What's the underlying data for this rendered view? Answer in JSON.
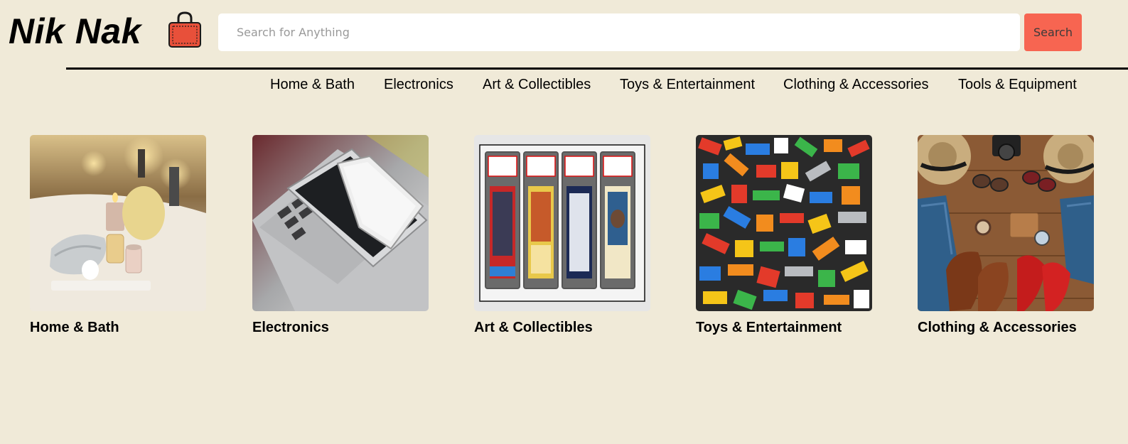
{
  "brand": {
    "name": "Nik Nak",
    "icon": "shopping-bag-icon",
    "icon_color": "#e8503a"
  },
  "search": {
    "placeholder": "Search for Anything",
    "value": "",
    "button_label": "Search",
    "button_color": "#f76551"
  },
  "nav": {
    "items": [
      {
        "label": "Home & Bath"
      },
      {
        "label": "Electronics"
      },
      {
        "label": "Art & Collectibles"
      },
      {
        "label": "Toys & Entertainment"
      },
      {
        "label": "Clothing & Accessories"
      },
      {
        "label": "Tools & Equipment"
      }
    ]
  },
  "categories": [
    {
      "label": "Home & Bath",
      "image": "spa-candles-towels-photo"
    },
    {
      "label": "Electronics",
      "image": "laptop-tablet-phone-photo"
    },
    {
      "label": "Art & Collectibles",
      "image": "graded-trading-cards-photo"
    },
    {
      "label": "Toys & Entertainment",
      "image": "lego-bricks-photo"
    },
    {
      "label": "Clothing & Accessories",
      "image": "hats-jeans-shoes-photo"
    }
  ],
  "colors": {
    "background": "#f0ead8",
    "accent": "#f76551"
  }
}
